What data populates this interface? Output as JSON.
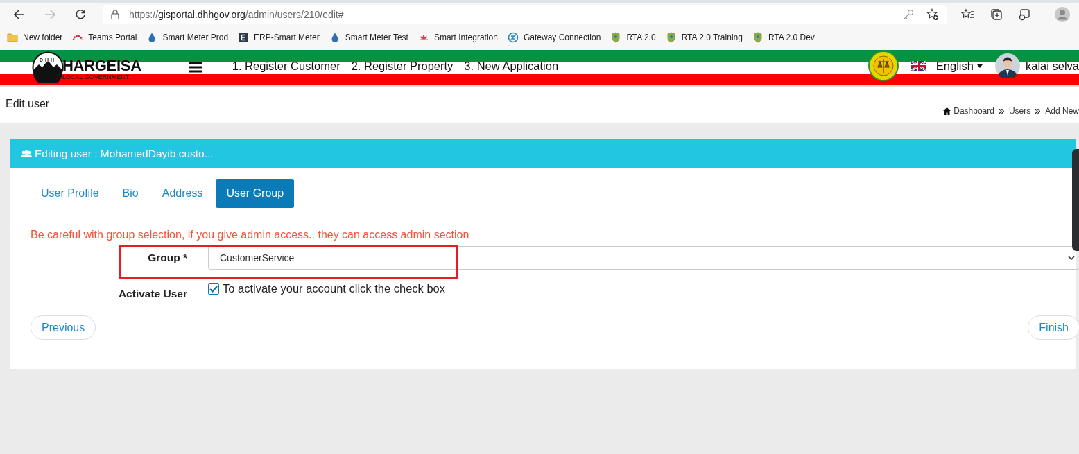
{
  "browser": {
    "url_scheme": "https://",
    "url_host": "gisportal.dhhgov.org",
    "url_path": "/admin/users/210/edit#",
    "bookmarks": [
      {
        "label": "New folder",
        "kind": "folder"
      },
      {
        "label": "Teams Portal",
        "kind": "gauge"
      },
      {
        "label": "Smart Meter Prod",
        "kind": "drop"
      },
      {
        "label": "ERP-Smart Meter",
        "kind": "letter"
      },
      {
        "label": "Smart Meter Test",
        "kind": "drop"
      },
      {
        "label": "Smart Integration",
        "kind": "flower"
      },
      {
        "label": "Gateway Connection",
        "kind": "swirl"
      },
      {
        "label": "RTA 2.0",
        "kind": "emblem"
      },
      {
        "label": "RTA 2.0 Training",
        "kind": "emblem"
      },
      {
        "label": "RTA 2.0 Dev",
        "kind": "emblem"
      }
    ]
  },
  "header": {
    "logo_letters": "DHH",
    "logo_title": "HARGEISA",
    "logo_subtitle": "LOCAL GOVERNMENT",
    "nav": [
      "1. Register Customer",
      "2. Register Property",
      "3. New Application"
    ],
    "language": "English",
    "user": "kalai selva"
  },
  "page": {
    "title": "Edit user",
    "breadcrumbs": [
      "Dashboard",
      "Users",
      "Add New"
    ]
  },
  "card": {
    "title": "Editing user : MohamedDayib custo...",
    "tabs": [
      {
        "label": "User Profile",
        "selected": false
      },
      {
        "label": "Bio",
        "selected": false
      },
      {
        "label": "Address",
        "selected": false
      },
      {
        "label": "User Group",
        "selected": true
      }
    ],
    "warning": "Be careful with group selection, if you give admin access.. they can access admin section",
    "group_label": "Group *",
    "group_value": "CustomerService",
    "activate_label": "Activate User",
    "activate_checked": true,
    "activate_text": "To activate your account click the check box",
    "buttons": [
      "Previous",
      "Finish"
    ]
  }
}
